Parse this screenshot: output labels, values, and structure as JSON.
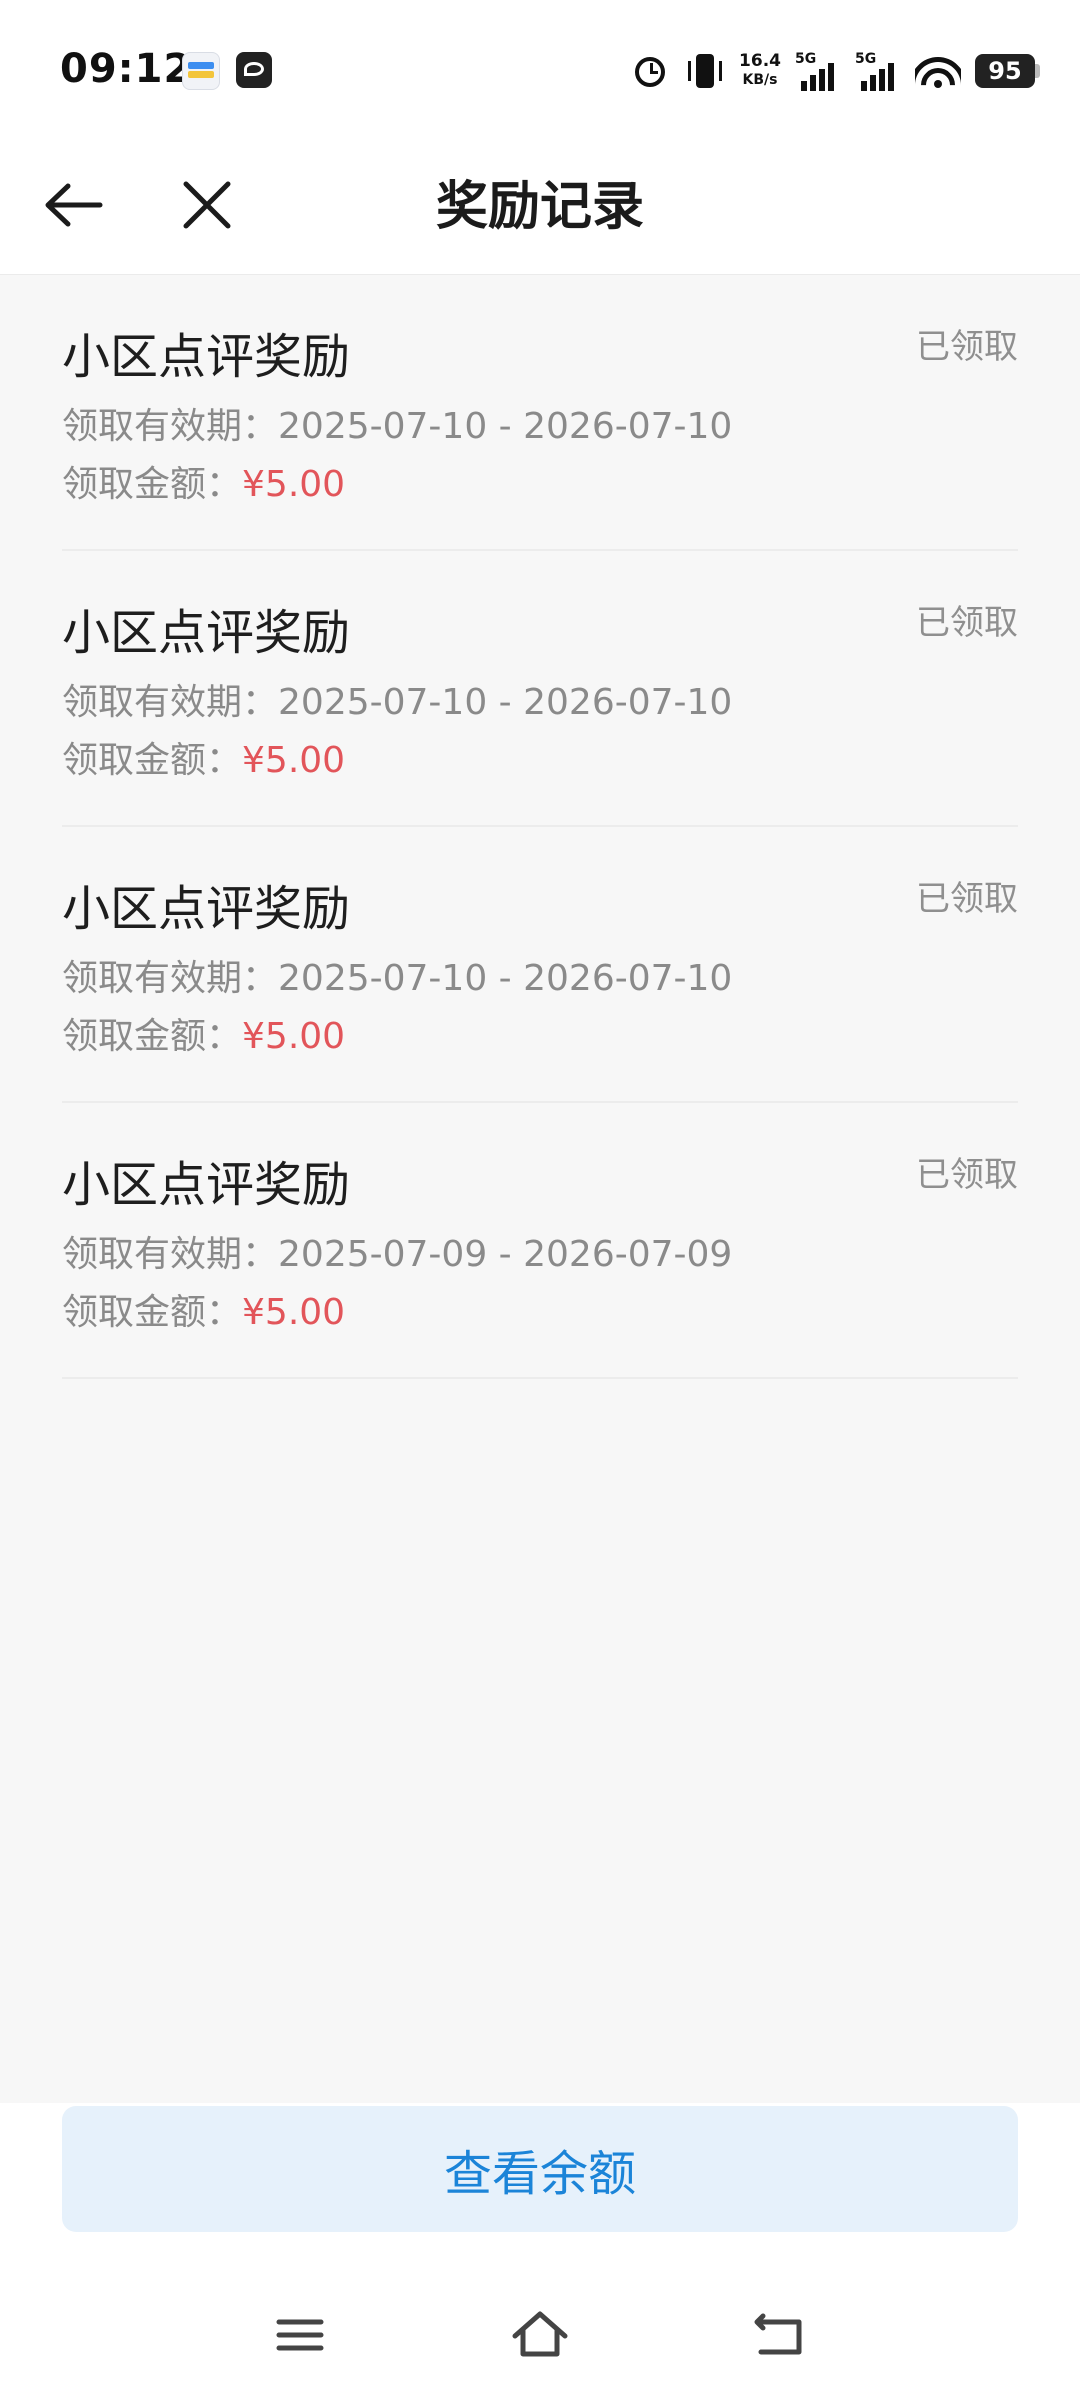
{
  "status_bar": {
    "time": "09:12",
    "net_speed_value": "16.4",
    "net_speed_unit": "KB/s",
    "sim1_network": "5G",
    "sim2_network": "5G",
    "battery_level": "95",
    "icons": [
      "wallet-app-icon",
      "bird-app-icon",
      "alarm-icon",
      "vibrate-icon",
      "signal-icon",
      "wifi-icon",
      "battery-icon"
    ]
  },
  "header": {
    "title": "奖励记录",
    "back_icon": "arrow-left-icon",
    "close_icon": "close-icon"
  },
  "records": [
    {
      "title": "小区点评奖励",
      "status": "已领取",
      "period_label": "领取有效期：",
      "period": "2025-07-10 - 2026-07-10",
      "amount_label": "领取金额：",
      "amount": "¥5.00"
    },
    {
      "title": "小区点评奖励",
      "status": "已领取",
      "period_label": "领取有效期：",
      "period": "2025-07-10 - 2026-07-10",
      "amount_label": "领取金额：",
      "amount": "¥5.00"
    },
    {
      "title": "小区点评奖励",
      "status": "已领取",
      "period_label": "领取有效期：",
      "period": "2025-07-10 - 2026-07-10",
      "amount_label": "领取金额：",
      "amount": "¥5.00"
    },
    {
      "title": "小区点评奖励",
      "status": "已领取",
      "period_label": "领取有效期：",
      "period": "2025-07-09 - 2026-07-09",
      "amount_label": "领取金额：",
      "amount": "¥5.00"
    }
  ],
  "footer": {
    "balance_button_label": "查看余额"
  },
  "system_nav": {
    "icons": [
      "menu-icon",
      "home-icon",
      "back-icon"
    ]
  },
  "colors": {
    "accent": "#1b84d8",
    "button_background": "#e6f1fb",
    "amount": "#e2555a",
    "secondary_text": "#8a8a8a",
    "page_background": "#f7f7f7"
  }
}
